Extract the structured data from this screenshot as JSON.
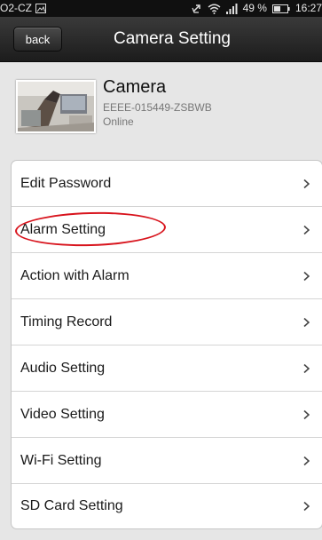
{
  "status_bar": {
    "carrier": "O2-CZ",
    "battery_percent": "49 %",
    "time": "16:27",
    "icons": [
      "image-notification-icon",
      "no-sync-icon",
      "wifi-icon",
      "signal-icon",
      "battery-icon"
    ]
  },
  "header": {
    "back_label": "back",
    "title": "Camera Setting"
  },
  "camera": {
    "name": "Camera",
    "id": "EEEE-015449-ZSBWB",
    "status": "Online"
  },
  "menu": {
    "items": [
      {
        "label": "Edit Password"
      },
      {
        "label": "Alarm Setting"
      },
      {
        "label": "Action with Alarm"
      },
      {
        "label": "Timing Record"
      },
      {
        "label": "Audio Setting"
      },
      {
        "label": "Video Setting"
      },
      {
        "label": "Wi-Fi Setting"
      },
      {
        "label": "SD Card Setting"
      }
    ]
  },
  "colors": {
    "header_bg": "#262626",
    "page_bg": "#e6e6e6",
    "highlight": "#d8141d"
  }
}
